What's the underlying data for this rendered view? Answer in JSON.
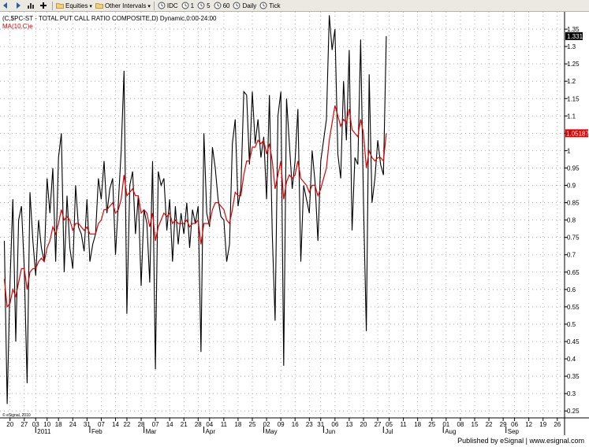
{
  "toolbar": {
    "items": [
      {
        "name": "nav-back-button",
        "icon": "back-arrow-icon",
        "label": ""
      },
      {
        "name": "nav-forward-button",
        "icon": "forward-arrow-icon",
        "label": ""
      },
      {
        "name": "chart-type-button",
        "icon": "bar-chart-icon",
        "label": ""
      },
      {
        "name": "crosshair-button",
        "icon": "plus-icon",
        "label": ""
      },
      {
        "name": "equities-dropdown",
        "icon": "folder-icon",
        "label": "Equities",
        "dropdown": true
      },
      {
        "name": "other-intervals-dropdown",
        "icon": "folder-icon",
        "label": "Other Intervals",
        "dropdown": true
      },
      {
        "name": "interval-idc-button",
        "icon": "clock-icon",
        "label": "IDC"
      },
      {
        "name": "interval-1-button",
        "icon": "clock-icon",
        "label": "1"
      },
      {
        "name": "interval-5-button",
        "icon": "clock-icon",
        "label": "5"
      },
      {
        "name": "interval-60-button",
        "icon": "clock-icon",
        "label": "60"
      },
      {
        "name": "interval-daily-button",
        "icon": "clock-icon",
        "label": "Daily"
      },
      {
        "name": "interval-tick-button",
        "icon": "clock-icon",
        "label": "Tick"
      }
    ]
  },
  "chart_header": {
    "symbol_line": "(C,$PC-ST - TOTAL PUT CALL RATIO COMPOSITE,D) Dynamic,0:00-24:00",
    "indicator_line": "MA(10,C)e"
  },
  "colors": {
    "price": "#000000",
    "ma": "#e00000",
    "grid": "#9a9a9a",
    "last_value_bg": "#000000",
    "ma_value_bg": "#e00000"
  },
  "watermark": "© eSignal, 2010",
  "footer": {
    "credit": "Published by eSignal | www.esignal.com"
  },
  "chart_data": {
    "type": "line",
    "title": "(C,$PC-ST - TOTAL PUT CALL RATIO COMPOSITE,D) Dynamic,0:00-24:00",
    "ylim": [
      0.23,
      1.4
    ],
    "y_ticks": [
      0.25,
      0.3,
      0.35,
      0.4,
      0.45,
      0.5,
      0.55,
      0.6,
      0.65,
      0.7,
      0.75,
      0.8,
      0.85,
      0.9,
      0.95,
      1,
      1.05,
      1.1,
      1.15,
      1.2,
      1.25,
      1.3,
      1.35
    ],
    "y_tick_labels": [
      "0.25",
      "0.3",
      "0.35",
      "0.4",
      "0.45",
      "0.5",
      "0.55",
      "0.6",
      "0.65",
      "0.7",
      "0.75",
      "0.8",
      "0.85",
      "0.9",
      "0.95",
      "1",
      "1.05",
      "1.1",
      "1.15",
      "1.2",
      "1.25",
      "1.3",
      "1.35"
    ],
    "x_day_labels": [
      {
        "idx": 2,
        "text": "20"
      },
      {
        "idx": 7,
        "text": "27"
      },
      {
        "idx": 11,
        "text": "03"
      },
      {
        "idx": 15,
        "text": "10"
      },
      {
        "idx": 19,
        "text": "18"
      },
      {
        "idx": 24,
        "text": "24"
      },
      {
        "idx": 29,
        "text": "31"
      },
      {
        "idx": 34,
        "text": "07"
      },
      {
        "idx": 39,
        "text": "14"
      },
      {
        "idx": 43,
        "text": "22"
      },
      {
        "idx": 48,
        "text": "28"
      },
      {
        "idx": 53,
        "text": "07"
      },
      {
        "idx": 58,
        "text": "14"
      },
      {
        "idx": 63,
        "text": "21"
      },
      {
        "idx": 68,
        "text": "28"
      },
      {
        "idx": 72,
        "text": "04"
      },
      {
        "idx": 77,
        "text": "11"
      },
      {
        "idx": 82,
        "text": "18"
      },
      {
        "idx": 87,
        "text": "25"
      },
      {
        "idx": 92,
        "text": "02"
      },
      {
        "idx": 97,
        "text": "09"
      },
      {
        "idx": 102,
        "text": "16"
      },
      {
        "idx": 107,
        "text": "23"
      },
      {
        "idx": 111,
        "text": "31"
      },
      {
        "idx": 116,
        "text": "06"
      },
      {
        "idx": 121,
        "text": "13"
      },
      {
        "idx": 126,
        "text": "20"
      },
      {
        "idx": 131,
        "text": "27"
      },
      {
        "idx": 135,
        "text": "05"
      },
      {
        "idx": 140,
        "text": "11"
      },
      {
        "idx": 145,
        "text": "18"
      },
      {
        "idx": 150,
        "text": "25"
      },
      {
        "idx": 155,
        "text": "01"
      },
      {
        "idx": 160,
        "text": "08"
      },
      {
        "idx": 165,
        "text": "15"
      },
      {
        "idx": 170,
        "text": "22"
      },
      {
        "idx": 175,
        "text": "29"
      },
      {
        "idx": 179,
        "text": "06"
      },
      {
        "idx": 184,
        "text": "12"
      },
      {
        "idx": 189,
        "text": "19"
      },
      {
        "idx": 194,
        "text": "26"
      }
    ],
    "x_month_labels": [
      {
        "idx": 11,
        "text": "2011"
      },
      {
        "idx": 30,
        "text": "Feb"
      },
      {
        "idx": 49,
        "text": "Mar"
      },
      {
        "idx": 70,
        "text": "Apr"
      },
      {
        "idx": 91,
        "text": "May"
      },
      {
        "idx": 112,
        "text": "Jun"
      },
      {
        "idx": 133,
        "text": "Jul"
      },
      {
        "idx": 154,
        "text": "Aug"
      },
      {
        "idx": 176,
        "text": "Sep"
      }
    ],
    "series": [
      {
        "name": "$PC-ST",
        "values": [
          0.74,
          0.27,
          0.62,
          0.86,
          0.45,
          0.8,
          0.84,
          0.66,
          0.33,
          0.88,
          0.74,
          0.64,
          0.8,
          0.72,
          0.68,
          0.92,
          0.82,
          0.95,
          0.68,
          0.98,
          1.05,
          0.65,
          0.87,
          0.72,
          0.66,
          0.9,
          0.78,
          0.76,
          0.71,
          0.86,
          0.68,
          0.73,
          0.76,
          0.92,
          0.86,
          0.97,
          0.82,
          0.89,
          0.92,
          0.7,
          0.85,
          1.0,
          1.23,
          0.53,
          0.9,
          0.94,
          0.76,
          0.87,
          0.61,
          0.83,
          0.79,
          0.62,
          0.97,
          0.37,
          0.94,
          0.9,
          0.92,
          0.77,
          0.86,
          0.68,
          0.84,
          0.73,
          0.82,
          0.76,
          0.85,
          0.72,
          0.83,
          0.79,
          0.84,
          0.42,
          1.05,
          0.82,
          0.78,
          1.01,
          0.95,
          0.86,
          0.81,
          0.8,
          0.68,
          0.73,
          1.02,
          1.09,
          0.84,
          0.89,
          1.17,
          1.16,
          0.96,
          1.17,
          1.02,
          1.09,
          0.98,
          1.04,
          0.86,
          1.16,
          0.76,
          0.51,
          1.1,
          1.17,
          0.38,
          1.15,
          1.02,
          0.89,
          0.97,
          1.12,
          0.68,
          0.9,
          0.86,
          0.82,
          1.0,
          0.91,
          0.74,
          0.97,
          1.03,
          1.09,
          1.39,
          1.29,
          1.35,
          0.99,
          0.92,
          1.2,
          1.03,
          1.29,
          0.77,
          0.98,
          0.96,
          1.32,
          0.85,
          0.48,
          1.22,
          0.85,
          0.92,
          1.03,
          0.96,
          0.93,
          1.33
        ]
      },
      {
        "name": "MA(10,C)e",
        "values": [
          0.63,
          0.55,
          0.56,
          0.6,
          0.58,
          0.62,
          0.66,
          0.66,
          0.6,
          0.65,
          0.66,
          0.66,
          0.68,
          0.69,
          0.68,
          0.72,
          0.74,
          0.78,
          0.76,
          0.79,
          0.83,
          0.8,
          0.81,
          0.8,
          0.77,
          0.79,
          0.79,
          0.78,
          0.77,
          0.78,
          0.76,
          0.76,
          0.76,
          0.79,
          0.8,
          0.83,
          0.83,
          0.84,
          0.85,
          0.82,
          0.83,
          0.86,
          0.93,
          0.87,
          0.88,
          0.89,
          0.87,
          0.87,
          0.82,
          0.83,
          0.82,
          0.78,
          0.82,
          0.74,
          0.78,
          0.8,
          0.82,
          0.81,
          0.82,
          0.79,
          0.8,
          0.79,
          0.79,
          0.79,
          0.8,
          0.78,
          0.79,
          0.79,
          0.8,
          0.73,
          0.79,
          0.79,
          0.79,
          0.83,
          0.85,
          0.85,
          0.84,
          0.83,
          0.8,
          0.79,
          0.83,
          0.88,
          0.87,
          0.87,
          0.93,
          0.97,
          0.97,
          1.01,
          1.01,
          1.03,
          1.02,
          1.03,
          0.99,
          1.02,
          0.97,
          0.89,
          0.93,
          0.97,
          0.86,
          0.91,
          0.93,
          0.92,
          0.93,
          0.97,
          0.92,
          0.91,
          0.9,
          0.88,
          0.9,
          0.9,
          0.87,
          0.89,
          0.92,
          0.95,
          1.03,
          1.08,
          1.13,
          1.1,
          1.07,
          1.09,
          1.08,
          1.12,
          1.06,
          1.05,
          1.04,
          1.09,
          1.05,
          0.95,
          1.0,
          0.98,
          0.97,
          0.98,
          0.98,
          0.97,
          1.05
        ]
      }
    ],
    "last_value_label": "1.331",
    "ma_value_label": "1.05187",
    "y_axis_side": "right",
    "grid": true
  }
}
